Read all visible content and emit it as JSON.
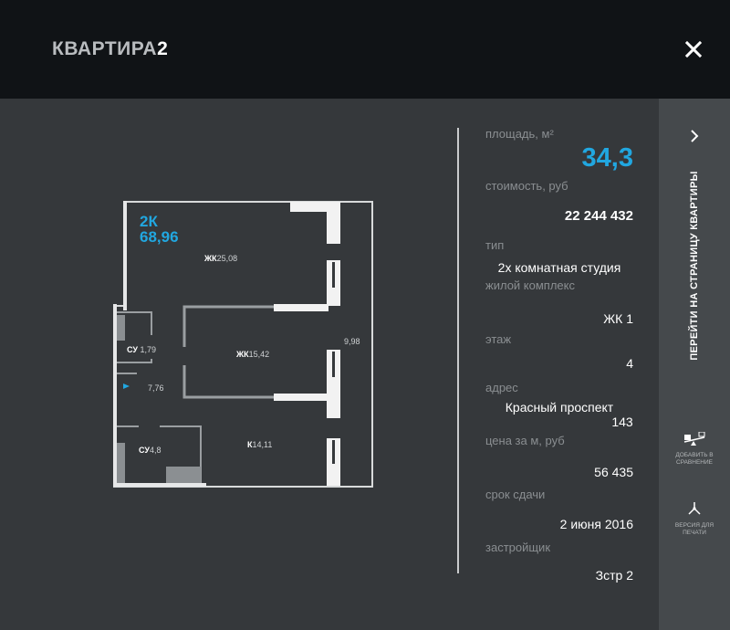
{
  "header": {
    "title_name": "КВАРТИРА",
    "title_number": "2"
  },
  "plan": {
    "tag_type": "2К",
    "tag_area": "68,96",
    "rooms": [
      {
        "code": "ЖК",
        "area": "25,08"
      },
      {
        "code": "СУ",
        "area": "1,79"
      },
      {
        "code": "ЖК",
        "area": "15,42"
      },
      {
        "code": "",
        "area": "9,98"
      },
      {
        "code": "",
        "area": "7,76"
      },
      {
        "code": "СУ",
        "area": "4,8"
      },
      {
        "code": "К",
        "area": "14,11"
      }
    ]
  },
  "info": {
    "area_label": "площадь, м²",
    "area_value": "34,3",
    "price_label": "стоимость, руб",
    "price_value": "22 244 432",
    "type_label": "тип",
    "type_value": "2х комнатная студия",
    "complex_label": "жилой комплекс",
    "complex_value": "ЖК 1",
    "floor_label": "этаж",
    "floor_value": "4",
    "address_label": "адрес",
    "address_line1": "Красный проспект",
    "address_line2": "143",
    "sqm_price_label": "цена за м, руб",
    "sqm_price_value": "56 435",
    "deadline_label": "срок сдачи",
    "deadline_value": "2 июня 2016",
    "developer_label": "застройщик",
    "developer_value": "Зстр 2"
  },
  "sidebar": {
    "go_label": "ПЕРЕЙТИ НА СТРАНИЦУ КВАРТИРЫ",
    "compare_label_1": "ДОБАВИТЬ В",
    "compare_label_2": "СРАВНЕНИЕ",
    "print_label_1": "ВЕРСИЯ ДЛЯ",
    "print_label_2": "ПЕЧАТИ"
  },
  "colors": {
    "accent": "#21a7e0",
    "topbar": "#101316",
    "background": "#35383b",
    "sidebar": "#45494c"
  },
  "icons": [
    "close-icon",
    "chevron-right-icon",
    "compare-scales-icon",
    "print-icon"
  ]
}
